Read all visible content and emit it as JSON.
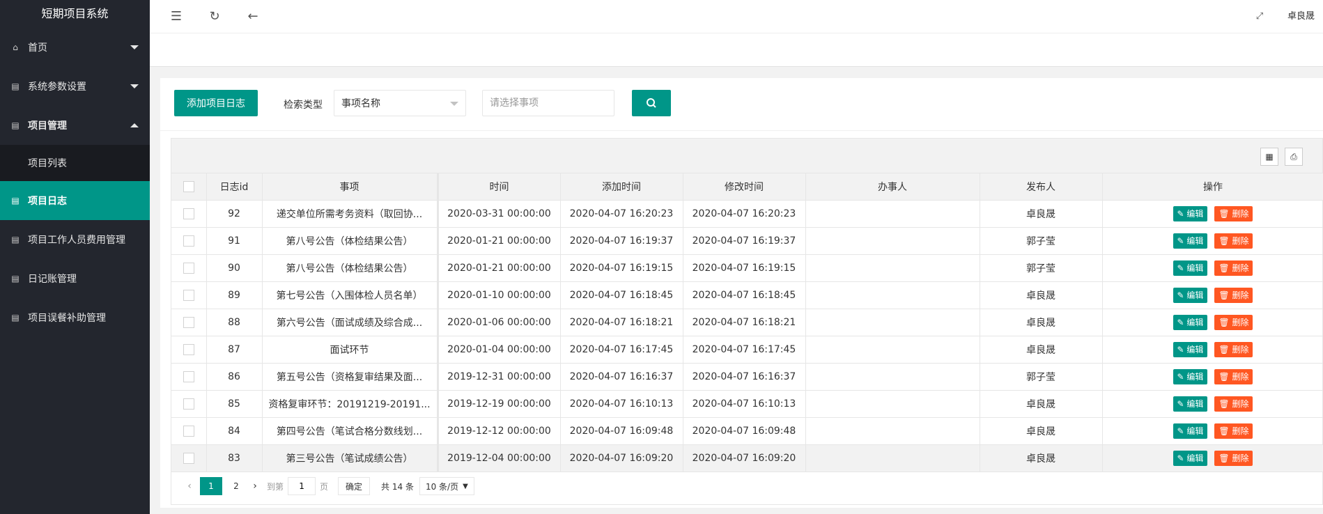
{
  "sidebar": {
    "brand": "短期项目系统",
    "items": [
      {
        "label": "首页",
        "icon": "home-icon"
      },
      {
        "label": "系统参数设置",
        "icon": "doc-icon"
      },
      {
        "label": "项目管理",
        "icon": "doc-icon"
      },
      {
        "label": "项目列表"
      },
      {
        "label": "项目日志",
        "icon": "doc-icon"
      },
      {
        "label": "项目工作人员费用管理",
        "icon": "doc-icon"
      },
      {
        "label": "日记账管理",
        "icon": "doc-icon"
      },
      {
        "label": "项目误餐补助管理",
        "icon": "doc-icon"
      }
    ]
  },
  "header": {
    "user": "卓良晟"
  },
  "toolbar": {
    "add_label": "添加项目日志",
    "search_type_label": "检索类型",
    "search_type_value": "事项名称",
    "search_placeholder": "请选择事项"
  },
  "table": {
    "columns": [
      "日志id",
      "事项",
      "时间",
      "添加时间",
      "修改时间",
      "办事人",
      "发布人",
      "操作"
    ],
    "edit_label": "编辑",
    "delete_label": "删除",
    "rows": [
      {
        "id": "92",
        "item": "递交单位所需考务资料（取回协...",
        "time": "2020-03-31 00:00:00",
        "added": "2020-04-07 16:20:23",
        "modified": "2020-04-07 16:20:23",
        "handler": "",
        "publisher": "卓良晟"
      },
      {
        "id": "91",
        "item": "第八号公告（体检结果公告）",
        "time": "2020-01-21 00:00:00",
        "added": "2020-04-07 16:19:37",
        "modified": "2020-04-07 16:19:37",
        "handler": "",
        "publisher": "郭子莹"
      },
      {
        "id": "90",
        "item": "第八号公告（体检结果公告）",
        "time": "2020-01-21 00:00:00",
        "added": "2020-04-07 16:19:15",
        "modified": "2020-04-07 16:19:15",
        "handler": "",
        "publisher": "郭子莹"
      },
      {
        "id": "89",
        "item": "第七号公告（入围体检人员名单）",
        "time": "2020-01-10 00:00:00",
        "added": "2020-04-07 16:18:45",
        "modified": "2020-04-07 16:18:45",
        "handler": "",
        "publisher": "卓良晟"
      },
      {
        "id": "88",
        "item": "第六号公告（面试成绩及综合成...",
        "time": "2020-01-06 00:00:00",
        "added": "2020-04-07 16:18:21",
        "modified": "2020-04-07 16:18:21",
        "handler": "",
        "publisher": "卓良晟"
      },
      {
        "id": "87",
        "item": "面试环节",
        "time": "2020-01-04 00:00:00",
        "added": "2020-04-07 16:17:45",
        "modified": "2020-04-07 16:17:45",
        "handler": "",
        "publisher": "卓良晟"
      },
      {
        "id": "86",
        "item": "第五号公告（资格复审结果及面...",
        "time": "2019-12-31 00:00:00",
        "added": "2020-04-07 16:16:37",
        "modified": "2020-04-07 16:16:37",
        "handler": "",
        "publisher": "郭子莹"
      },
      {
        "id": "85",
        "item": "资格复审环节：20191219-20191...",
        "time": "2019-12-19 00:00:00",
        "added": "2020-04-07 16:10:13",
        "modified": "2020-04-07 16:10:13",
        "handler": "",
        "publisher": "卓良晟"
      },
      {
        "id": "84",
        "item": "第四号公告（笔试合格分数线划...",
        "time": "2019-12-12 00:00:00",
        "added": "2020-04-07 16:09:48",
        "modified": "2020-04-07 16:09:48",
        "handler": "",
        "publisher": "卓良晟"
      },
      {
        "id": "83",
        "item": "第三号公告（笔试成绩公告）",
        "time": "2019-12-04 00:00:00",
        "added": "2020-04-07 16:09:20",
        "modified": "2020-04-07 16:09:20",
        "handler": "",
        "publisher": "卓良晟"
      }
    ]
  },
  "pager": {
    "current": "1",
    "next_page": "2",
    "goto_label": "到第",
    "goto_value": "1",
    "page_unit": "页",
    "confirm": "确定",
    "total": "共 14 条",
    "page_size": "10 条/页"
  },
  "colors": {
    "accent": "#009688",
    "danger": "#ff5722",
    "sidebar_bg": "#23262e"
  }
}
